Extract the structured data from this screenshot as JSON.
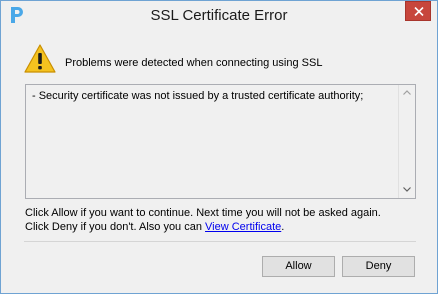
{
  "window": {
    "title": "SSL Certificate Error",
    "app_icon": "p-logo-icon",
    "close_icon": "close-icon"
  },
  "message": {
    "icon": "warning-icon",
    "text": "Problems were detected when connecting using SSL"
  },
  "details": {
    "text": "- Security certificate was not issued by a trusted certificate authority;"
  },
  "instructions": {
    "line1": "Click Allow if you want to continue. Next time you will not be asked again.",
    "line2_prefix": "Click Deny if you don't. Also you can ",
    "link": "View Certificate",
    "line2_suffix": "."
  },
  "buttons": {
    "allow": "Allow",
    "deny": "Deny"
  },
  "colors": {
    "close_button": "#c7463c",
    "link": "#0000ee",
    "app_icon": "#4aa8e8",
    "warning": "#f4c21f"
  }
}
